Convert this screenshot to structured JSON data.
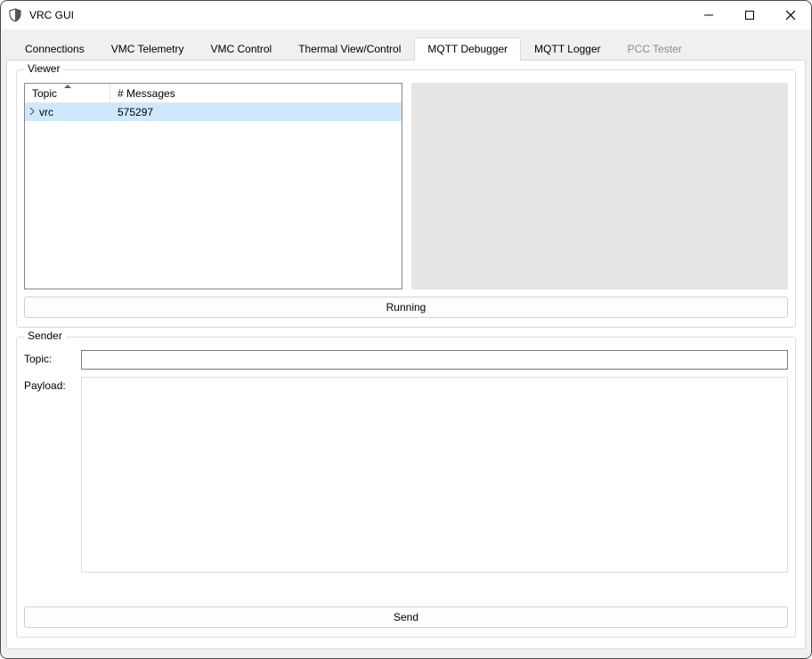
{
  "window": {
    "title": "VRC GUI"
  },
  "tabs": [
    {
      "label": "Connections",
      "active": false,
      "disabled": false
    },
    {
      "label": "VMC Telemetry",
      "active": false,
      "disabled": false
    },
    {
      "label": "VMC Control",
      "active": false,
      "disabled": false
    },
    {
      "label": "Thermal View/Control",
      "active": false,
      "disabled": false
    },
    {
      "label": "MQTT Debugger",
      "active": true,
      "disabled": false
    },
    {
      "label": "MQTT Logger",
      "active": false,
      "disabled": false
    },
    {
      "label": "PCC Tester",
      "active": false,
      "disabled": true
    }
  ],
  "viewer": {
    "legend": "Viewer",
    "columns": {
      "topic": "Topic",
      "messages": "# Messages"
    },
    "rows": [
      {
        "topic": "vrc",
        "messages": "575297",
        "selected": true,
        "expandable": true
      }
    ],
    "running_label": "Running"
  },
  "sender": {
    "legend": "Sender",
    "topic_label": "Topic:",
    "topic_value": "",
    "payload_label": "Payload:",
    "payload_value": "",
    "send_label": "Send"
  }
}
